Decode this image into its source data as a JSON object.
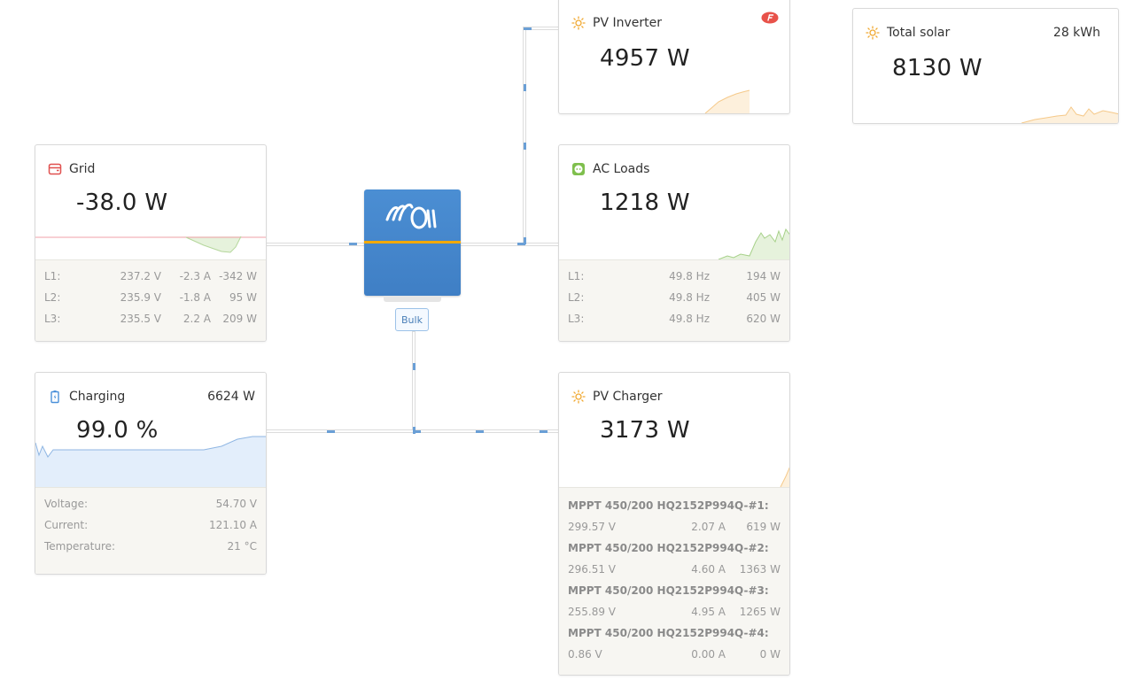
{
  "grid": {
    "title": "Grid",
    "power": "-38.0 W",
    "phases": [
      {
        "label": "L1:",
        "voltage": "237.2 V",
        "current": "-2.3 A",
        "power": "-342 W"
      },
      {
        "label": "L2:",
        "voltage": "235.9 V",
        "current": "-1.8 A",
        "power": "95 W"
      },
      {
        "label": "L3:",
        "voltage": "235.5 V",
        "current": "2.2 A",
        "power": "209 W"
      }
    ],
    "icon": "grid-meter-icon",
    "color": "#e0504f"
  },
  "battery": {
    "title": "Charging",
    "power": "6624 W",
    "soc": "99.0 %",
    "rows": [
      {
        "label": "Voltage:",
        "value": "54.70 V"
      },
      {
        "label": "Current:",
        "value": "121.10 A"
      },
      {
        "label": "Temperature:",
        "value": "21 °C"
      }
    ],
    "icon": "battery-charging-icon",
    "color": "#4a90d9"
  },
  "inverter": {
    "state": "Bulk",
    "icon": "victron-logo"
  },
  "pv_inverter": {
    "title": "PV Inverter",
    "power": "4957 W",
    "badge_icon": "fronius-logo-icon",
    "icon": "sun-icon",
    "color": "#f0a830"
  },
  "ac_loads": {
    "title": "AC Loads",
    "power": "1218 W",
    "phases": [
      {
        "label": "L1:",
        "frequency": "49.8 Hz",
        "power": "194 W"
      },
      {
        "label": "L2:",
        "frequency": "49.8 Hz",
        "power": "405 W"
      },
      {
        "label": "L3:",
        "frequency": "49.8 Hz",
        "power": "620 W"
      }
    ],
    "icon": "socket-icon",
    "color": "#7fbf4d"
  },
  "pv_charger": {
    "title": "PV Charger",
    "power": "3173 W",
    "chargers": [
      {
        "name": "MPPT 450/200 HQ2152P994Q-#1:",
        "voltage": "299.57 V",
        "current": "2.07 A",
        "power": "619 W"
      },
      {
        "name": "MPPT 450/200 HQ2152P994Q-#2:",
        "voltage": "296.51 V",
        "current": "4.60 A",
        "power": "1363 W"
      },
      {
        "name": "MPPT 450/200 HQ2152P994Q-#3:",
        "voltage": "255.89 V",
        "current": "4.95 A",
        "power": "1265 W"
      },
      {
        "name": "MPPT 450/200 HQ2152P994Q-#4:",
        "voltage": "0.86 V",
        "current": "0.00 A",
        "power": "0 W"
      }
    ],
    "icon": "sun-icon"
  },
  "total_solar": {
    "title": "Total solar",
    "energy": "28 kWh",
    "power": "8130 W",
    "icon": "sun-icon"
  }
}
